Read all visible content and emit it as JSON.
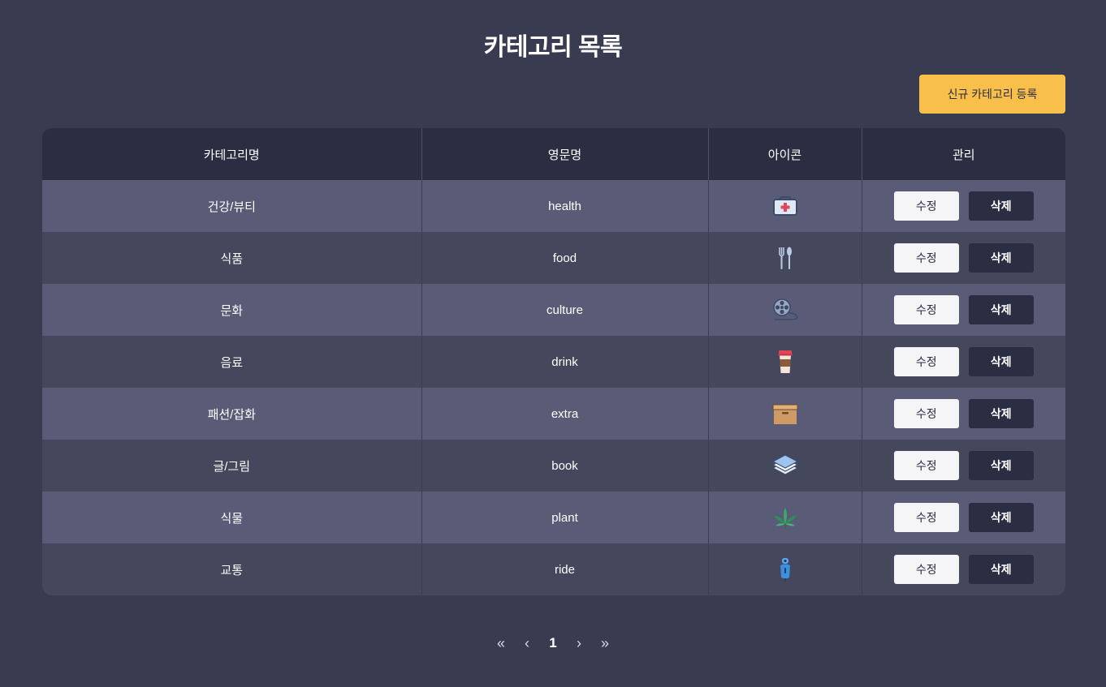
{
  "page": {
    "title": "카테고리 목록",
    "new_button_label": "신규 카테고리 등록"
  },
  "table": {
    "headers": [
      "카테고리명",
      "영문명",
      "아이콘",
      "관리"
    ],
    "rows": [
      {
        "name": "건강/뷰티",
        "english": "health",
        "icon": "first-aid-kit-icon"
      },
      {
        "name": "식품",
        "english": "food",
        "icon": "fork-spoon-icon"
      },
      {
        "name": "문화",
        "english": "culture",
        "icon": "film-reel-icon"
      },
      {
        "name": "음료",
        "english": "drink",
        "icon": "coffee-cup-icon"
      },
      {
        "name": "패션/잡화",
        "english": "extra",
        "icon": "box-icon"
      },
      {
        "name": "글/그림",
        "english": "book",
        "icon": "stacked-pages-icon"
      },
      {
        "name": "식물",
        "english": "plant",
        "icon": "leaf-plant-icon"
      },
      {
        "name": "교통",
        "english": "ride",
        "icon": "scooter-icon"
      }
    ],
    "edit_label": "수정",
    "delete_label": "삭제"
  },
  "pagination": {
    "first": "«",
    "prev": "‹",
    "current": "1",
    "next": "›",
    "last": "»"
  },
  "colors": {
    "background": "#393b50",
    "header": "#2b2d42",
    "row_odd": "#5a5c77",
    "row_even": "#45475d",
    "accent": "#f9bf4b"
  }
}
